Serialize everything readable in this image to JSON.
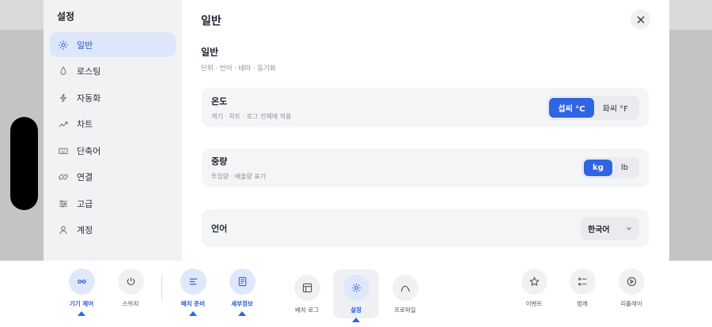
{
  "colors": {
    "accent": "#2f65e3",
    "sidebar_bg": "#f1f2f4",
    "card_bg": "#f4f5f7"
  },
  "sidebar": {
    "title": "설정",
    "items": [
      {
        "label": "일반",
        "icon": "sun-icon",
        "active": true
      },
      {
        "label": "로스팅",
        "icon": "droplet-icon",
        "active": false
      },
      {
        "label": "자동화",
        "icon": "lightning-icon",
        "active": false
      },
      {
        "label": "차트",
        "icon": "trend-icon",
        "active": false
      },
      {
        "label": "단축어",
        "icon": "keyboard-icon",
        "active": false
      },
      {
        "label": "연결",
        "icon": "link-icon",
        "active": false
      },
      {
        "label": "고급",
        "icon": "sliders-icon",
        "active": false
      },
      {
        "label": "계정",
        "icon": "user-icon",
        "active": false
      }
    ]
  },
  "main": {
    "title": "일반",
    "section_title": "일반",
    "section_sub": "단위 · 언어 · 테마 · 동기화",
    "temperature": {
      "label": "온도",
      "desc": "계기 · 차트 · 로그 전체에 적용",
      "options": [
        "섭씨 °C",
        "화씨 °F"
      ],
      "selected": "섭씨 °C"
    },
    "weight": {
      "label": "중량",
      "desc": "투입량 · 배출량 표기",
      "options": [
        "kg",
        "lb"
      ],
      "selected": "kg"
    },
    "language": {
      "label": "언어",
      "value": "한국어"
    }
  },
  "toolbar": {
    "items": [
      {
        "label": "기기 제어",
        "icon": "link-icon",
        "selected": true
      },
      {
        "label": "스위치",
        "icon": "power-icon",
        "selected": false
      },
      {
        "label": "배치 준비",
        "icon": "list-icon",
        "selected": true
      },
      {
        "label": "세부정보",
        "icon": "document-icon",
        "selected": true
      },
      {
        "label": "배치 로그",
        "icon": "layout-icon",
        "selected": false
      },
      {
        "label": "설정",
        "icon": "gear-icon",
        "selected": true
      },
      {
        "label": "프로파일",
        "icon": "curve-icon",
        "selected": false
      },
      {
        "label": "이벤트",
        "icon": "star-icon",
        "selected": false
      },
      {
        "label": "범례",
        "icon": "legend-icon",
        "selected": false
      },
      {
        "label": "리플레이",
        "icon": "play-icon",
        "selected": false
      }
    ]
  }
}
